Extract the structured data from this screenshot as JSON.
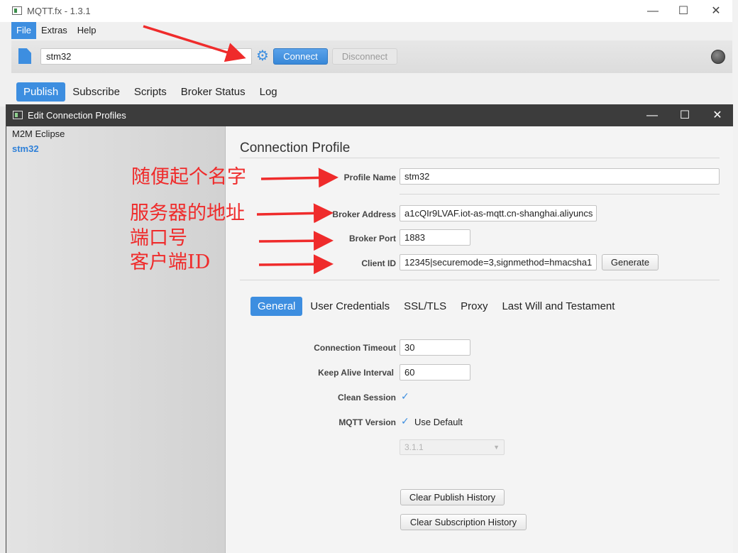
{
  "main_window": {
    "title": "MQTT.fx - 1.3.1",
    "controls": {
      "minimize": "—",
      "maximize": "☐",
      "close": "✕"
    },
    "menu": [
      "File",
      "Extras",
      "Help"
    ],
    "active_menu_index": 0,
    "toolbar": {
      "profile_value": "stm32",
      "connect_label": "Connect",
      "disconnect_label": "Disconnect",
      "status": "disconnected"
    },
    "tabs": [
      "Publish",
      "Subscribe",
      "Scripts",
      "Broker Status",
      "Log"
    ],
    "active_tab_index": 0
  },
  "dialog": {
    "title": "Edit Connection Profiles",
    "controls": {
      "minimize": "—",
      "maximize": "☐",
      "close": "✕"
    },
    "profiles": [
      "M2M Eclipse",
      "stm32"
    ],
    "selected_profile_index": 1,
    "section_title": "Connection Profile",
    "fields": {
      "profile_name": {
        "label": "Profile Name",
        "value": "stm32"
      },
      "broker_address": {
        "label": "Broker Address",
        "value": "a1cQIr9LVAF.iot-as-mqtt.cn-shanghai.aliyuncs"
      },
      "broker_port": {
        "label": "Broker Port",
        "value": "1883"
      },
      "client_id": {
        "label": "Client ID",
        "value": "12345|securemode=3,signmethod=hmacsha1"
      }
    },
    "generate_label": "Generate",
    "subtabs": [
      "General",
      "User Credentials",
      "SSL/TLS",
      "Proxy",
      "Last Will and Testament"
    ],
    "active_subtab_index": 0,
    "general": {
      "connection_timeout": {
        "label": "Connection Timeout",
        "value": "30"
      },
      "keep_alive_interval": {
        "label": "Keep Alive Interval",
        "value": "60"
      },
      "clean_session": {
        "label": "Clean Session",
        "checked": true
      },
      "mqtt_version": {
        "label": "MQTT Version",
        "use_default_label": "Use Default",
        "checked": true,
        "selected_version": "3.1.1"
      },
      "clear_publish_history_label": "Clear Publish History",
      "clear_subscription_history_label": "Clear Subscription History"
    }
  },
  "annotations": {
    "profile_name_note": "随便起个名字",
    "broker_address_note": "服务器的地址",
    "port_note": "端口号",
    "client_id_note": "客户端ID",
    "color": "#ef2b2b"
  },
  "colors": {
    "accent": "#3d8ee0",
    "dialog_titlebar": "#3c3c3c"
  }
}
